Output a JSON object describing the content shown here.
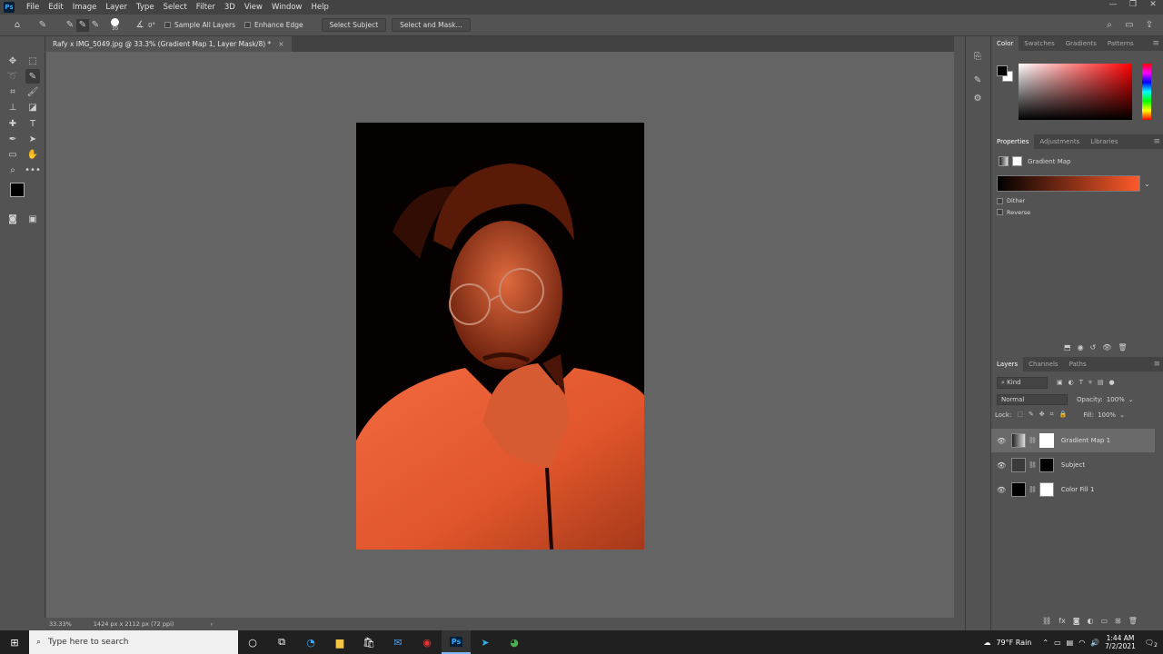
{
  "menubar": {
    "app_logo": "Ps",
    "items": [
      "File",
      "Edit",
      "Image",
      "Layer",
      "Type",
      "Select",
      "Filter",
      "3D",
      "View",
      "Window",
      "Help"
    ]
  },
  "options": {
    "brush_size": "30",
    "angle": "0°",
    "sample_all_layers": "Sample All Layers",
    "enhance_edge": "Enhance Edge",
    "select_subject": "Select Subject",
    "select_and_mask": "Select and Mask..."
  },
  "document": {
    "tab_title": "Rafy x IMG_5049.jpg @ 33.3% (Gradient Map 1, Layer Mask/8) *",
    "close": "×"
  },
  "status": {
    "zoom": "33.33%",
    "dimensions": "1424 px x 2112 px (72 ppi)"
  },
  "color_panel": {
    "tabs": [
      "Color",
      "Swatches",
      "Gradients",
      "Patterns"
    ],
    "foreground": "#000000",
    "background": "#ffffff",
    "hue": "#ff0000"
  },
  "properties": {
    "tabs": [
      "Properties",
      "Adjustments",
      "Libraries"
    ],
    "title": "Gradient Map",
    "gradient_from": "#000000",
    "gradient_to": "#ff5a2a",
    "dither": "Dither",
    "reverse": "Reverse"
  },
  "layers_panel": {
    "tabs": [
      "Layers",
      "Channels",
      "Paths"
    ],
    "filter": "Kind",
    "blend_mode": "Normal",
    "opacity_label": "Opacity:",
    "opacity": "100%",
    "lock_label": "Lock:",
    "fill_label": "Fill:",
    "fill": "100%",
    "layers": [
      {
        "name": "Gradient Map 1",
        "selected": true
      },
      {
        "name": "Subject",
        "selected": false
      },
      {
        "name": "Color Fill 1",
        "selected": false
      }
    ]
  },
  "taskbar": {
    "search_placeholder": "Type here to search",
    "weather": "79°F  Rain",
    "time": "1:44 AM",
    "date": "7/2/2021",
    "notification_count": "2"
  }
}
